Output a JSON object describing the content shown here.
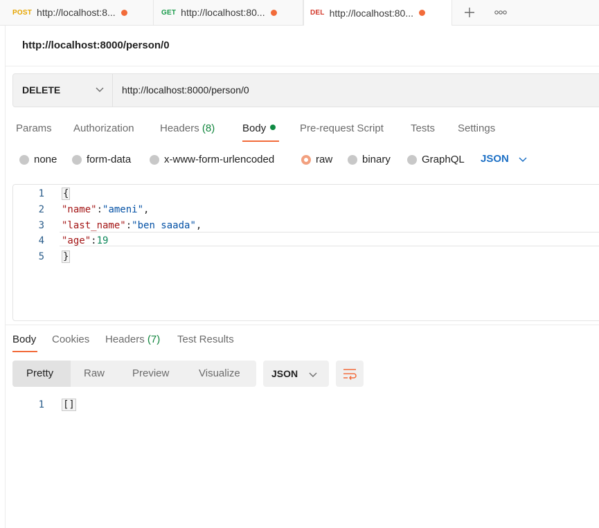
{
  "tabs": [
    {
      "method": "POST",
      "method_color": "#e6a500",
      "label": "http://localhost:8..."
    },
    {
      "method": "GET",
      "method_color": "#1a9b4b",
      "label": "http://localhost:80..."
    },
    {
      "method": "DEL",
      "method_color": "#d33a2c",
      "label": "http://localhost:80..."
    }
  ],
  "tab_icons": [
    "plus-icon",
    "more-icon"
  ],
  "request": {
    "title": "http://localhost:8000/person/0",
    "method": "DELETE",
    "url": "http://localhost:8000/person/0"
  },
  "request_tabs": {
    "params": "Params",
    "authorization": "Authorization",
    "headers": "Headers",
    "headers_count": "(8)",
    "body": "Body",
    "prerequest": "Pre-request Script",
    "tests": "Tests",
    "settings": "Settings"
  },
  "body_types": {
    "none": "none",
    "form_data": "form-data",
    "urlencoded": "x-www-form-urlencoded",
    "raw": "raw",
    "binary": "binary",
    "graphql": "GraphQL",
    "selected": "raw",
    "format": "JSON"
  },
  "editor": {
    "line_numbers": [
      "1",
      "2",
      "3",
      "4",
      "5"
    ],
    "open_brace": "{",
    "close_brace": "}",
    "k_name": "\"name\"",
    "v_name": "\"ameni\"",
    "k_last": "\"last_name\"",
    "v_last": "\"ben saada\"",
    "k_age": "\"age\"",
    "v_age": "19",
    "colon": ":",
    "comma": ","
  },
  "response": {
    "tabs": {
      "body": "Body",
      "cookies": "Cookies",
      "headers": "Headers",
      "headers_count": "(7)",
      "test_results": "Test Results"
    },
    "views": [
      "Pretty",
      "Raw",
      "Preview",
      "Visualize"
    ],
    "active_view": "Pretty",
    "format": "JSON",
    "line_numbers": [
      "1"
    ],
    "content": "[]"
  },
  "colors": {
    "accent": "#f26b3a",
    "link_blue": "#1d70c5",
    "count_green": "#10853c"
  }
}
